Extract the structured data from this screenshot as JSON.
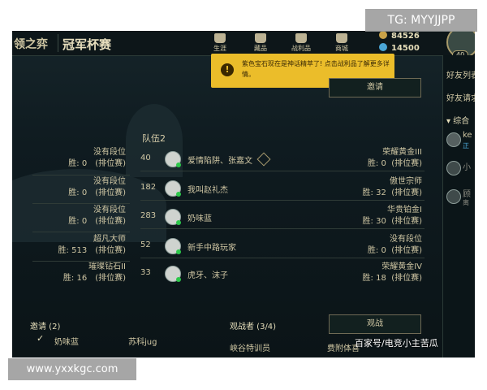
{
  "watermarks": {
    "tg": "TG: MYYJJPP",
    "url": "www.yxxkgc.com",
    "baijia": "百家号/电竞小主苦瓜"
  },
  "header": {
    "title_left": "领之弈",
    "title_main": "冠军杯赛",
    "nav": [
      {
        "label": "生涯",
        "icon": "career-icon"
      },
      {
        "label": "藏品",
        "icon": "collection-icon"
      },
      {
        "label": "战利品",
        "icon": "loot-icon"
      },
      {
        "label": "商城",
        "icon": "store-icon"
      }
    ],
    "currency_be": "84526",
    "currency_rp": "14500",
    "level": "40"
  },
  "tooltip": {
    "message": "紫色宝石现在是神话精萃了! 点击战利品了解更多详情。"
  },
  "main": {
    "top_button": "邀请",
    "team_title": "队伍2",
    "left_rows": [
      {
        "rank": "没有段位",
        "wins_label": "胜: 0",
        "queue": "(排位赛)"
      },
      {
        "rank": "没有段位",
        "wins_label": "胜: 0",
        "queue": "(排位赛)"
      },
      {
        "rank": "没有段位",
        "wins_label": "胜: 0",
        "queue": "(排位赛)"
      },
      {
        "rank": "超凡大师",
        "wins_label": "胜: 513",
        "queue": "(排位赛)"
      },
      {
        "rank": "璀璨钻石II",
        "wins_label": "胜: 16",
        "queue": "(排位赛)"
      }
    ],
    "team_rows": [
      {
        "level": "40",
        "name": "爱情陷阱、张嘉文",
        "rank": "荣耀黄金III",
        "wins_label": "胜: 0",
        "queue": "(排位赛)"
      },
      {
        "level": "182",
        "name": "我叫赵礼杰",
        "rank": "傲世宗师",
        "wins_label": "胜: 32",
        "queue": "(排位赛)"
      },
      {
        "level": "283",
        "name": "奶味蓝",
        "rank": "华贵铂金I",
        "wins_label": "胜: 30",
        "queue": "(排位赛)"
      },
      {
        "level": "52",
        "name": "新手中路玩家",
        "rank": "没有段位",
        "wins_label": "胜: 0",
        "queue": "(排位赛)"
      },
      {
        "level": "33",
        "name": "虎牙、沫子",
        "rank": "荣耀黄金IV",
        "wins_label": "胜: 18",
        "queue": "(排位赛)"
      }
    ],
    "spectate_button": "观战",
    "invites_label": "邀请 (2)",
    "invite_1": "奶味蓝",
    "invite_2": "苏科jug",
    "spectators_label": "观战者 (3/4)",
    "spectator_1": "峡谷特训员",
    "spectator_2": "费附体喜"
  },
  "right_panel": {
    "friends_list": "好友列表",
    "friend_requests": "好友请求",
    "group": "综合",
    "friend_1": "ke",
    "friend_1_status": "正",
    "friend_2": "小",
    "friend_3": "顾",
    "friend_3_status": "离"
  }
}
